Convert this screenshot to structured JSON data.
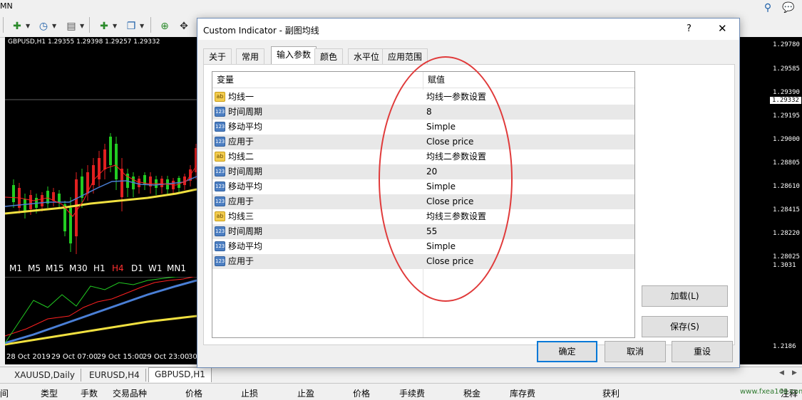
{
  "toolbar": {
    "left_label": "MN"
  },
  "chart": {
    "symbol_info": "GBPUSD,H1  1.29355 1.29398 1.29257 1.29332",
    "timeframes": [
      {
        "label": "M1",
        "selected": false
      },
      {
        "label": "M5",
        "selected": false
      },
      {
        "label": "M15",
        "selected": false
      },
      {
        "label": "M30",
        "selected": false
      },
      {
        "label": "H1",
        "selected": false
      },
      {
        "label": "H4",
        "selected": true
      },
      {
        "label": "D1",
        "selected": false
      },
      {
        "label": "W1",
        "selected": false
      },
      {
        "label": "MN1",
        "selected": false
      }
    ],
    "time_labels": [
      "28 Oct 2019",
      "29 Oct 07:00",
      "29 Oct 15:00",
      "29 Oct 23:00",
      "30"
    ],
    "price_labels": [
      "1.29780",
      "1.29585",
      "1.29390",
      "1.29332",
      "1.29195",
      "1.29000",
      "1.28805",
      "1.28610",
      "1.28415",
      "1.28220",
      "1.28025",
      "1.3031",
      "1.2186"
    ],
    "current_price": "1.29332"
  },
  "dialog": {
    "title": "Custom Indicator - 副图均线",
    "help_label": "?",
    "close_label": "✕",
    "tabs": [
      {
        "label": "关于",
        "active": false
      },
      {
        "label": "常用",
        "active": false
      },
      {
        "label": "输入参数",
        "active": true
      },
      {
        "label": "颜色",
        "active": false
      },
      {
        "label": "水平位",
        "active": false
      },
      {
        "label": "应用范围",
        "active": false
      }
    ],
    "table": {
      "col_variable": "变量",
      "col_value": "赋值",
      "rows": [
        {
          "icon": "ab",
          "name": "均线一",
          "value": "均线一参数设置"
        },
        {
          "icon": "123",
          "name": "时间周期",
          "value": "8"
        },
        {
          "icon": "123",
          "name": "移动平均",
          "value": "Simple"
        },
        {
          "icon": "123",
          "name": "应用于",
          "value": "Close price"
        },
        {
          "icon": "ab",
          "name": "均线二",
          "value": "均线二参数设置"
        },
        {
          "icon": "123",
          "name": "时间周期",
          "value": "20"
        },
        {
          "icon": "123",
          "name": "移动平均",
          "value": "Simple"
        },
        {
          "icon": "123",
          "name": "应用于",
          "value": "Close price"
        },
        {
          "icon": "ab",
          "name": "均线三",
          "value": "均线三参数设置"
        },
        {
          "icon": "123",
          "name": "时间周期",
          "value": "55"
        },
        {
          "icon": "123",
          "name": "移动平均",
          "value": "Simple"
        },
        {
          "icon": "123",
          "name": "应用于",
          "value": "Close price"
        }
      ]
    },
    "load_label": "加载(L)",
    "save_label": "保存(S)",
    "ok_label": "确定",
    "cancel_label": "取消",
    "reset_label": "重设"
  },
  "sheet_tabs": [
    {
      "label": "XAUUSD,Daily",
      "active": false
    },
    {
      "label": "EURUSD,H4",
      "active": false
    },
    {
      "label": "GBPUSD,H1",
      "active": true
    }
  ],
  "terminal_headers": [
    "间",
    "类型",
    "手数",
    "交易品种",
    "价格",
    "止损",
    "止盈",
    "价格",
    "手续费",
    "税金",
    "库存费",
    "获利",
    "注释"
  ],
  "watermark": "www.fxea168.com",
  "colors": {
    "annotation": "#e03a3a",
    "accent": "#0078d7",
    "ma_fast": "#ff2020",
    "ma_mid": "#4a7fd6",
    "ma_slow": "#f0e040"
  }
}
